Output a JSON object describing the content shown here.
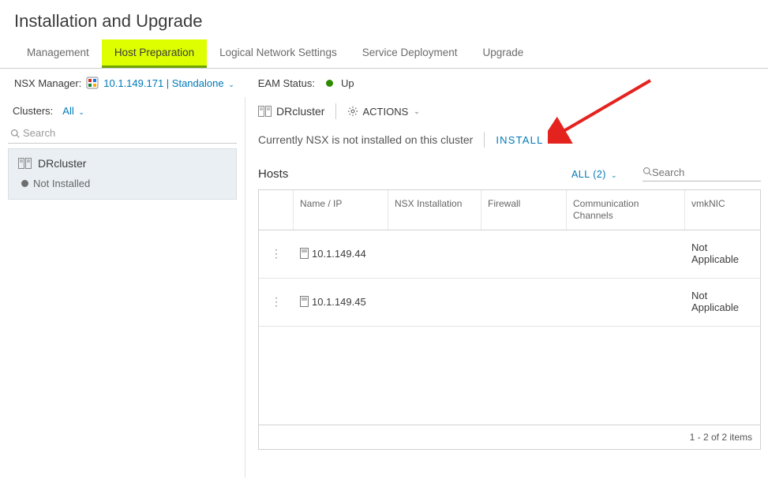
{
  "page_title": "Installation and Upgrade",
  "tabs": [
    {
      "label": "Management"
    },
    {
      "label": "Host Preparation",
      "active": true
    },
    {
      "label": "Logical Network Settings"
    },
    {
      "label": "Service Deployment"
    },
    {
      "label": "Upgrade"
    }
  ],
  "nsx_manager": {
    "label": "NSX Manager:",
    "ip": "10.1.149.171",
    "mode": "Standalone"
  },
  "eam": {
    "label": "EAM Status:",
    "status": "Up",
    "color": "#2e8b00"
  },
  "sidebar": {
    "clusters_label": "Clusters:",
    "all_label": "All",
    "search_placeholder": "Search",
    "cluster": {
      "name": "DRcluster",
      "status": "Not Installed"
    }
  },
  "content": {
    "cluster_label": "DRcluster",
    "actions_label": "ACTIONS",
    "install_message": "Currently NSX is not installed on this cluster",
    "install_link": "INSTALL NSX",
    "hosts": {
      "title": "Hosts",
      "all_label": "ALL (2)",
      "search_placeholder": "Search",
      "columns": [
        "",
        "Name / IP",
        "NSX Installation",
        "Firewall",
        "Communication Channels",
        "vmkNIC"
      ],
      "rows": [
        {
          "ip": "10.1.149.44",
          "nsx": "",
          "firewall": "",
          "comm": "",
          "vmknic": "Not Applicable"
        },
        {
          "ip": "10.1.149.45",
          "nsx": "",
          "firewall": "",
          "comm": "",
          "vmknic": "Not Applicable"
        }
      ],
      "footer": "1 - 2 of 2 items"
    }
  }
}
